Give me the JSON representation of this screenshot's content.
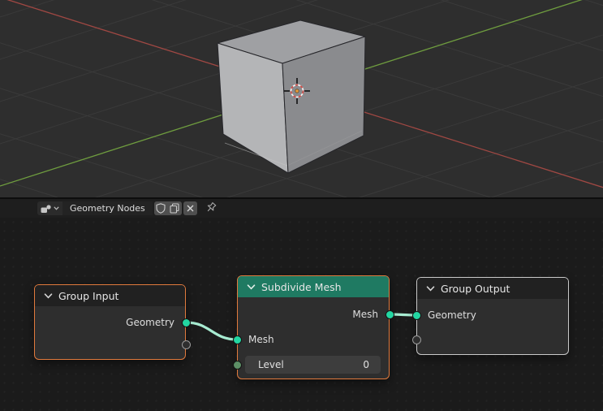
{
  "viewport": {
    "object": "cube",
    "colors": {
      "background": "#2e2e2e",
      "grid": "#3a3a3a",
      "x_axis": "#a04843",
      "y_axis": "#6f9d3f",
      "cube_top": "#9fa0a3",
      "cube_left": "#b4b5b7",
      "cube_right": "#8a8b8e",
      "cursor_red": "#cf4b45",
      "origin_orange": "#e59a3c"
    }
  },
  "node_editor": {
    "header": {
      "tree_icon": "nodetree-icon",
      "tree_name": "Geometry Nodes",
      "shield_icon": "shield-icon",
      "duplicate_icon": "duplicate-icon",
      "close_icon": "x-icon",
      "pin_icon": "pin-icon"
    },
    "colors": {
      "canvas": "#1b1b1b",
      "node_body": "#2e2e2e",
      "node_header_dark": "#212121",
      "node_header_green": "#1f7a62",
      "selected_border": "#e17a3d",
      "active_border": "#c9c9c9",
      "geometry_socket": "#23d6a2",
      "integer_socket": "#5d8f66",
      "link": "#a8ecd2"
    },
    "nodes": [
      {
        "title": "Group Input",
        "state": "selected",
        "outputs": [
          {
            "label": "Geometry",
            "type": "geometry"
          }
        ]
      },
      {
        "title": "Subdivide Mesh",
        "state": "selected",
        "outputs": [
          {
            "label": "Mesh",
            "type": "geometry"
          }
        ],
        "inputs": [
          {
            "label": "Mesh",
            "type": "geometry"
          }
        ],
        "fields": [
          {
            "label": "Level",
            "value": "0",
            "type": "integer"
          }
        ]
      },
      {
        "title": "Group Output",
        "state": "active",
        "inputs": [
          {
            "label": "Geometry",
            "type": "geometry"
          }
        ]
      }
    ],
    "links": [
      {
        "from": "Group Input.Geometry",
        "to": "Subdivide Mesh.Mesh"
      },
      {
        "from": "Subdivide Mesh.Mesh",
        "to": "Group Output.Geometry"
      }
    ]
  }
}
